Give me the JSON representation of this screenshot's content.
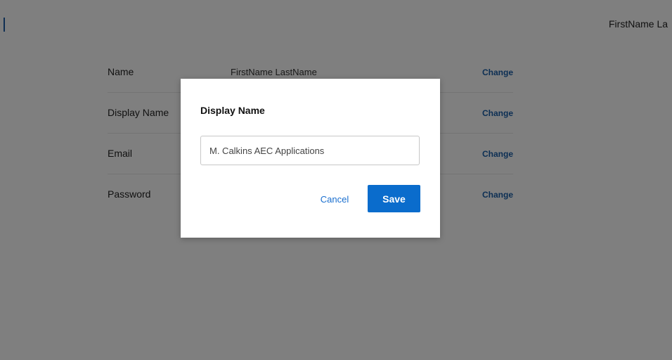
{
  "header": {
    "user_name": "FirstName La"
  },
  "settings": {
    "rows": [
      {
        "label": "Name",
        "value": "FirstName LastName",
        "action": "Change"
      },
      {
        "label": "Display Name",
        "value": "",
        "action": "Change"
      },
      {
        "label": "Email",
        "value": "",
        "action": "Change"
      },
      {
        "label": "Password",
        "value": "",
        "action": "Change"
      }
    ]
  },
  "modal": {
    "title": "Display Name",
    "input_value": "M. Calkins AEC Applications",
    "cancel_label": "Cancel",
    "save_label": "Save"
  },
  "colors": {
    "accent": "#0a6ccc",
    "link": "#1a5fa8",
    "overlay": "rgba(0,0,0,0.5)"
  }
}
